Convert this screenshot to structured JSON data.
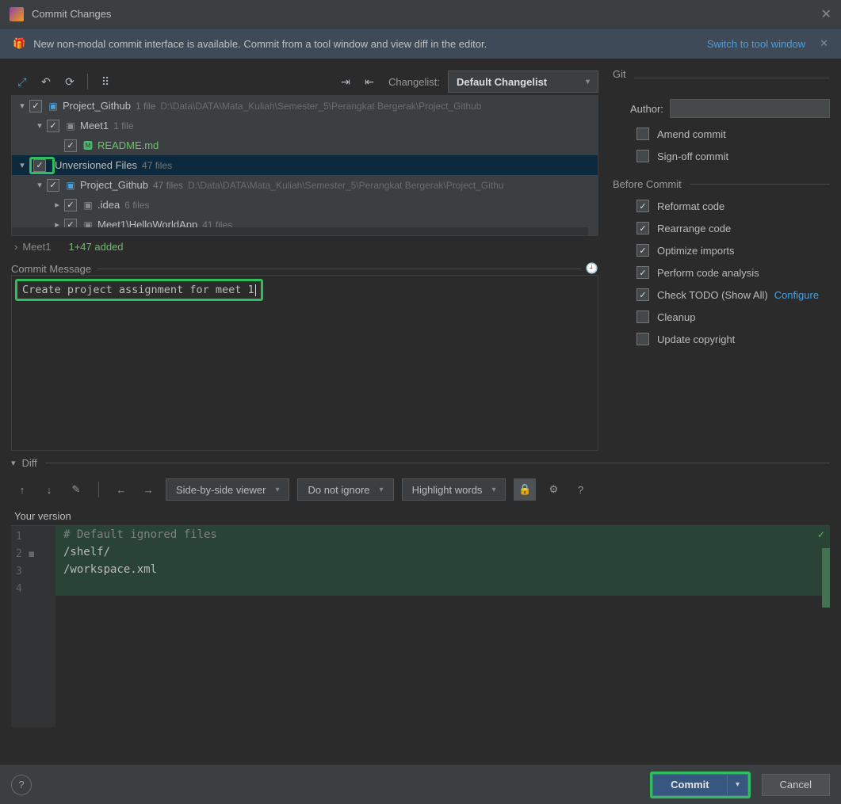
{
  "title": "Commit Changes",
  "banner": {
    "text": "New non-modal commit interface is available. Commit from a tool window and view diff in the editor.",
    "link": "Switch to tool window"
  },
  "toolbar": {
    "changelist_label": "Changelist:",
    "changelist_value": "Default Changelist"
  },
  "tree": {
    "nodes": [
      {
        "indent": 0,
        "chev": "▾",
        "name": "Project_Github",
        "count": "1 file",
        "path": "D:\\Data\\DATA\\Mata_Kuliah\\Semester_5\\Perangkat Bergerak\\Project_Github",
        "icon": "folder-blue"
      },
      {
        "indent": 1,
        "chev": "▾",
        "name": "Meet1",
        "count": "1 file",
        "icon": "folder-gray"
      },
      {
        "indent": 2,
        "chev": "",
        "name": "README.md",
        "icon": "md",
        "nameColor": "#6ebf6e"
      },
      {
        "indent": 0,
        "chev": "▾",
        "name": "Unversioned Files",
        "count": "47 files",
        "sel": true,
        "highlightCb": true
      },
      {
        "indent": 1,
        "chev": "▾",
        "name": "Project_Github",
        "count": "47 files",
        "path": "D:\\Data\\DATA\\Mata_Kuliah\\Semester_5\\Perangkat Bergerak\\Project_Githu",
        "icon": "folder-blue"
      },
      {
        "indent": 2,
        "chev": "▸",
        "name": ".idea",
        "count": "6 files",
        "icon": "folder-gray"
      },
      {
        "indent": 2,
        "chev": "▸",
        "name": "Meet1\\HelloWorldApp",
        "count": "41 files",
        "icon": "folder-gray"
      }
    ]
  },
  "footer": {
    "name": "Meet1",
    "added": "1+47 added"
  },
  "commit_message": {
    "label": "Commit Message",
    "text": "Create project assignment for meet 1"
  },
  "git": {
    "label": "Git",
    "author_label": "Author:",
    "amend": "Amend commit",
    "signoff": "Sign-off commit"
  },
  "before": {
    "label": "Before Commit",
    "items": [
      {
        "label": "Reformat code",
        "checked": true
      },
      {
        "label": "Rearrange code",
        "checked": true
      },
      {
        "label": "Optimize imports",
        "checked": true
      },
      {
        "label": "Perform code analysis",
        "checked": true
      },
      {
        "label": "Check TODO (Show All)",
        "checked": true,
        "link": "Configure"
      },
      {
        "label": "Cleanup",
        "checked": false
      },
      {
        "label": "Update copyright",
        "checked": false
      }
    ]
  },
  "diff": {
    "label": "Diff",
    "viewer": "Side-by-side viewer",
    "ignore": "Do not ignore",
    "highlight": "Highlight words",
    "your_version": "Your version",
    "lines": [
      {
        "n": "1",
        "icon": "",
        "text": "# Default ignored files",
        "cls": "comment"
      },
      {
        "n": "2",
        "icon": "◼",
        "text": "/shelf/",
        "cls": "txt"
      },
      {
        "n": "3",
        "icon": "",
        "text": "/workspace.xml",
        "cls": "txt"
      },
      {
        "n": "4",
        "icon": "",
        "text": "",
        "cls": "txt"
      }
    ]
  },
  "buttons": {
    "commit": "Commit",
    "cancel": "Cancel"
  }
}
